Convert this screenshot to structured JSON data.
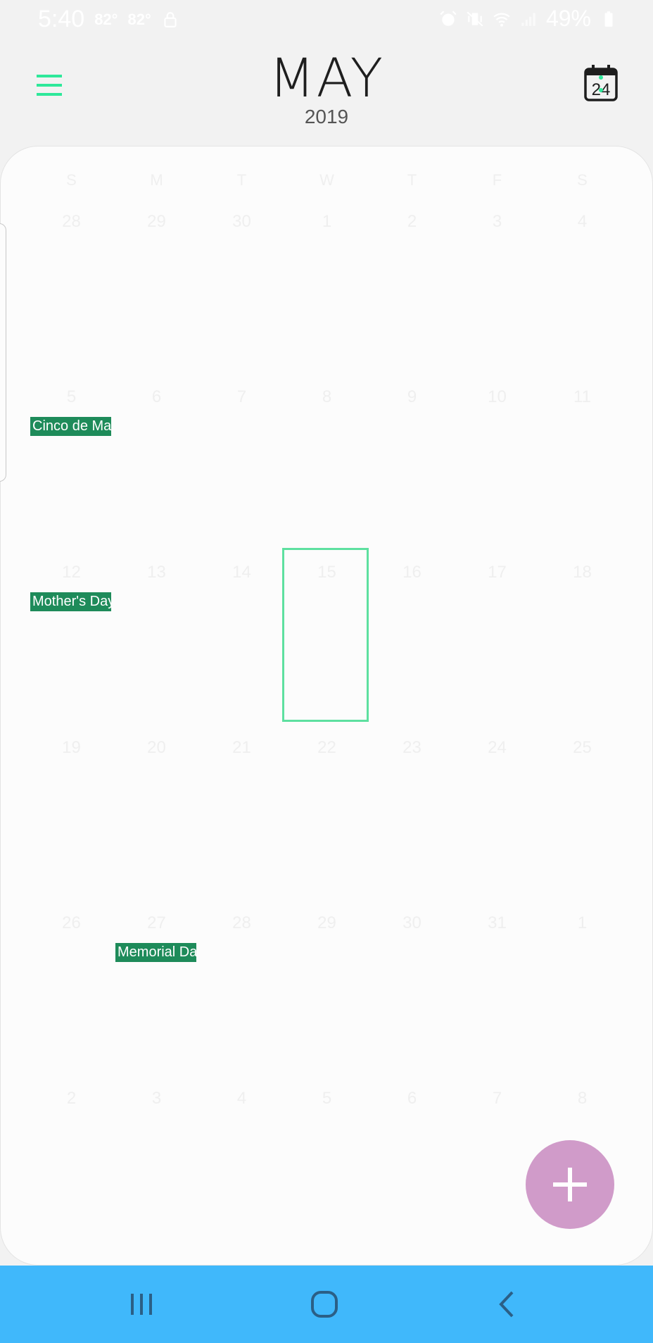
{
  "status_bar": {
    "time": "5:40",
    "temps": [
      "82°",
      "82°"
    ],
    "battery": "49%",
    "icons": [
      "lock-icon",
      "alarm-icon",
      "vibrate-icon",
      "wifi-icon",
      "signal-icon",
      "battery-icon"
    ]
  },
  "header": {
    "month": "MAY",
    "year": "2019",
    "menu_icon": "hamburger-menu-icon",
    "today_icon": "calendar-today-icon",
    "today_number": "24"
  },
  "weekdays": [
    "S",
    "M",
    "T",
    "W",
    "T",
    "F",
    "S"
  ],
  "weeks": [
    [
      "28",
      "29",
      "30",
      "1",
      "2",
      "3",
      "4"
    ],
    [
      "5",
      "6",
      "7",
      "8",
      "9",
      "10",
      "11"
    ],
    [
      "12",
      "13",
      "14",
      "15",
      "16",
      "17",
      "18"
    ],
    [
      "19",
      "20",
      "21",
      "22",
      "23",
      "24",
      "25"
    ],
    [
      "26",
      "27",
      "28",
      "29",
      "30",
      "31",
      "1"
    ],
    [
      "2",
      "3",
      "4",
      "5",
      "6",
      "7",
      "8"
    ]
  ],
  "events": [
    {
      "label": "Cinco de Ma",
      "week": 1,
      "day": 0
    },
    {
      "label": "Mother's Day",
      "week": 2,
      "day": 0
    },
    {
      "label": "Memorial Da",
      "week": 4,
      "day": 1
    }
  ],
  "selected_day": "15",
  "fab": {
    "icon": "plus-icon",
    "color": "#d09bc9"
  },
  "colors": {
    "accent": "#2ee89a",
    "event_bg": "#1e8b5a",
    "nav_bar": "#40b8fb",
    "selection": "#5ee0a0"
  },
  "nav_bar": {
    "buttons": [
      "recent-apps-icon",
      "home-icon",
      "back-icon"
    ]
  }
}
